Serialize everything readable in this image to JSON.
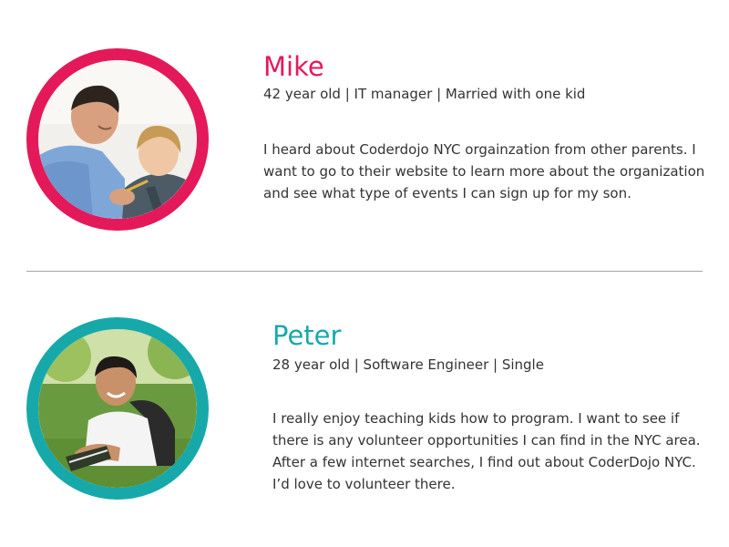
{
  "theme": {
    "mike_accent": "#e4195a",
    "peter_accent": "#17a9aa"
  },
  "personas": [
    {
      "name": "Mike",
      "meta": "42 year old | IT manager | Married with one kid",
      "story": "I heard about Coderdojo NYC orgainzation from other parents. I want to go to their website to learn more about the organization and see what type of events I can sign up for my son."
    },
    {
      "name": "Peter",
      "meta": "28 year old | Software Engineer | Single",
      "story": "I really enjoy teaching kids how to program. I want to see if there is any volunteer opportunities I can find in the NYC area. After a few internet searches, I find out about CoderDojo NYC. I’d love to volunteer there."
    }
  ]
}
